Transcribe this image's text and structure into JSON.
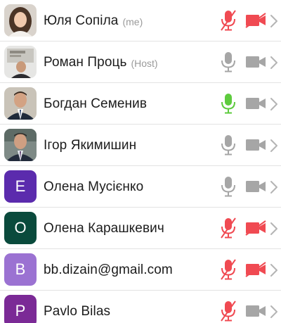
{
  "colors": {
    "muted_red": "#f04a52",
    "mic_gray": "#a6a6a6",
    "speaking_green": "#5ecb3e",
    "chevron_gray": "#b4b4b4"
  },
  "participants": [
    {
      "name": "Юля Сопіла",
      "role": "(me)",
      "avatar_type": "photo",
      "mic": "muted",
      "video": "off"
    },
    {
      "name": "Роман Проць",
      "role": "(Host)",
      "avatar_type": "photo",
      "mic": "on",
      "video": "idle"
    },
    {
      "name": "Богдан Семенив",
      "role": "",
      "avatar_type": "photo",
      "mic": "speaking",
      "video": "idle"
    },
    {
      "name": "Ігор Якимишин",
      "role": "",
      "avatar_type": "photo",
      "mic": "on",
      "video": "idle"
    },
    {
      "name": "Олена Мусієнко",
      "role": "",
      "avatar_type": "letter",
      "initial": "E",
      "avatar_color": "#5b2bad",
      "mic": "on",
      "video": "idle"
    },
    {
      "name": "Олена Карашкевич",
      "role": "",
      "avatar_type": "letter",
      "initial": "O",
      "avatar_color": "#0a4a3c",
      "mic": "muted",
      "video": "off"
    },
    {
      "name": "bb.dizain@gmail.com",
      "role": "",
      "avatar_type": "letter",
      "initial": "B",
      "avatar_color": "#9b72d2",
      "mic": "muted",
      "video": "off"
    },
    {
      "name": "Pavlo Bilas",
      "role": "",
      "avatar_type": "letter",
      "initial": "P",
      "avatar_color": "#7b2a96",
      "mic": "muted",
      "video": "idle"
    }
  ]
}
